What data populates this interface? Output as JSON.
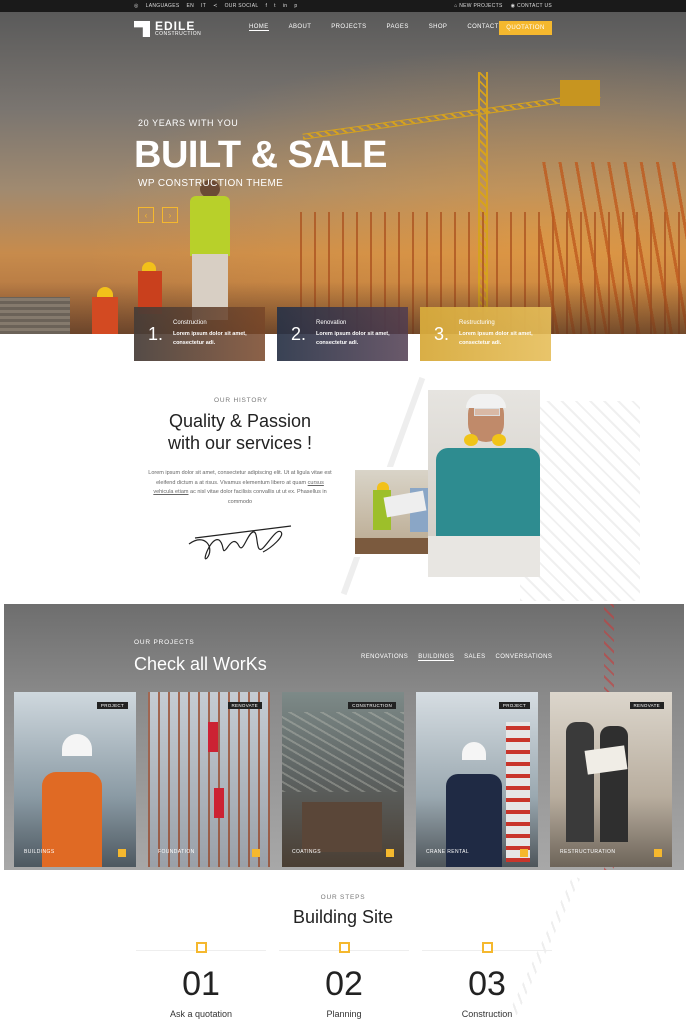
{
  "topbar": {
    "languages": "LANGUAGES",
    "lang_en": "EN",
    "lang_it": "IT",
    "social": "OUR SOCIAL",
    "social_icons": [
      "facebook-icon",
      "twitter-icon",
      "linkedin-icon",
      "pinterest-icon"
    ],
    "new_projects": "NEW PROJECTS",
    "contact_us": "CONTACT US"
  },
  "brand": {
    "name": "EDILE",
    "tagline": "CONSTRUCTION"
  },
  "nav": {
    "items": [
      {
        "label": "HOME"
      },
      {
        "label": "ABOUT"
      },
      {
        "label": "PROJECTS"
      },
      {
        "label": "PAGES"
      },
      {
        "label": "SHOP"
      },
      {
        "label": "CONTACT"
      }
    ],
    "quotation": "QUOTATION"
  },
  "hero": {
    "subtitle": "20 YEARS WITH YOU",
    "title": "BUILT & SALE",
    "tagline": "WP CONSTRUCTION THEME",
    "prev": "‹",
    "next": "›"
  },
  "features": [
    {
      "num": "1.",
      "title": "Construction",
      "desc": "Lorem ipsum dolor sit amet, consectetur adi."
    },
    {
      "num": "2.",
      "title": "Renovation",
      "desc": "Lorem ipsum dolor sit amet, consectetur adi."
    },
    {
      "num": "3.",
      "title": "Restructuring",
      "desc": "Lorem ipsum dolor sit amet, consectetur adi."
    }
  ],
  "history": {
    "eyebrow": "OUR HISTORY",
    "title_l1": "Quality & Passion",
    "title_l2": "with our services !",
    "body_1": "Lorem ipsum dolor sit amet, consectetur adipiscing elit. Ut at ligula vitae est eleifend dictum a at risus. Vivamus elementum libero at quam",
    "body_link": "cursus vehicula etiam",
    "body_2": "ac nisl vitae dolor facilisis convallis ut ut ex. Phasellus in commodo"
  },
  "projects": {
    "eyebrow": "OUR PROJECTS",
    "title": "Check all WorKs",
    "filters": [
      {
        "label": "RENOVATIONS"
      },
      {
        "label": "BUILDINGS"
      },
      {
        "label": "SALES"
      },
      {
        "label": "CONVERSATIONS"
      }
    ],
    "cards": [
      {
        "tag": "PROJECT",
        "caption": "BUILDINGS"
      },
      {
        "tag": "RENOVATE",
        "caption": "FOUNDATION"
      },
      {
        "tag": "CONSTRUCTION",
        "caption": "COATINGS"
      },
      {
        "tag": "PROJECT",
        "caption": "CRANE RENTAL"
      },
      {
        "tag": "RENOVATE",
        "caption": "RESTRUCTURATION"
      }
    ]
  },
  "steps": {
    "eyebrow": "OUR STEPS",
    "title": "Building Site",
    "items": [
      {
        "num": "01",
        "label": "Ask a quotation"
      },
      {
        "num": "02",
        "label": "Planning"
      },
      {
        "num": "03",
        "label": "Construction"
      }
    ]
  },
  "colors": {
    "accent": "#f5b82e",
    "dark": "#1a1a1a"
  }
}
